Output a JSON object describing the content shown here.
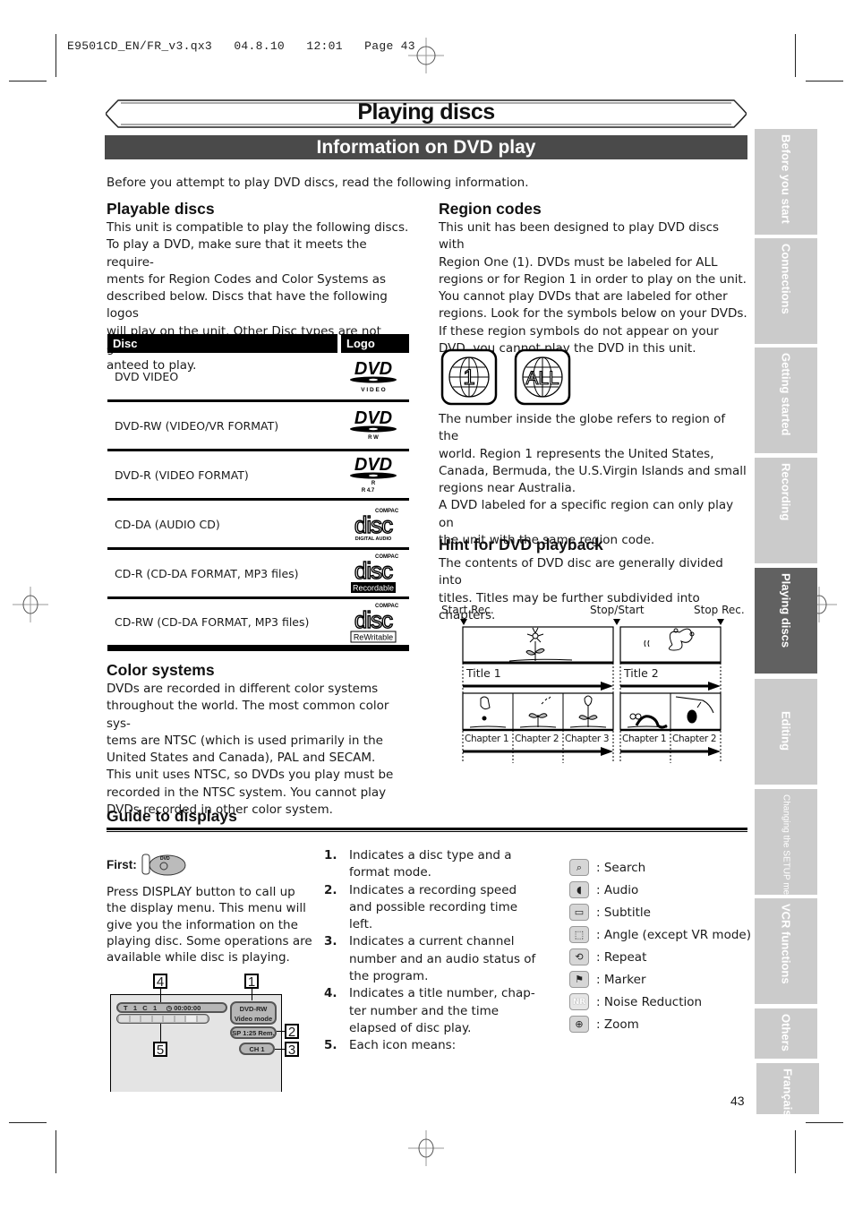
{
  "slug": "E9501CD_EN/FR_v3.qx3   04.8.10   12:01   Page 43",
  "page_title": "Playing discs",
  "section_title": "Information on DVD play",
  "intro": "Before you attempt to play DVD discs, read the following information.",
  "playable": {
    "heading": "Playable discs",
    "lines": [
      "This unit is compatible to play the following discs.",
      "To play a DVD, make sure that it meets the require-",
      "ments for Region Codes and Color Systems as",
      "described below. Discs that have the following logos",
      "will play on the unit. Other Disc types are not guar-",
      "anteed to play."
    ],
    "table": {
      "headers": [
        "Disc",
        "Logo"
      ],
      "rows": [
        {
          "disc": "DVD VIDEO",
          "logo": "dvd-video-logo",
          "sub": "V I D E O"
        },
        {
          "disc": "DVD-RW (VIDEO/VR FORMAT)",
          "logo": "dvd-rw-logo",
          "sub": "R W"
        },
        {
          "disc": "DVD-R (VIDEO FORMAT)",
          "logo": "dvd-r-logo",
          "sub": "R 4.7"
        },
        {
          "disc": "CD-DA (AUDIO CD)",
          "logo": "cd-digital-audio-logo",
          "sub": "DIGITAL AUDIO"
        },
        {
          "disc": "CD-R (CD-DA FORMAT, MP3 files)",
          "logo": "cd-recordable-logo",
          "sub": "Recordable"
        },
        {
          "disc": "CD-RW (CD-DA FORMAT, MP3 files)",
          "logo": "cd-rewritable-logo",
          "sub": "ReWritable"
        }
      ]
    }
  },
  "color_systems": {
    "heading": "Color systems",
    "lines": [
      "DVDs are recorded in different color systems",
      "throughout the world. The most common color sys-",
      "tems are NTSC (which is used primarily in the",
      "United States and Canada), PAL and SECAM.",
      "This unit uses NTSC, so DVDs you play must be",
      "recorded in the NTSC system. You cannot play",
      "DVDs recorded in other color system."
    ]
  },
  "region_codes": {
    "heading": "Region codes",
    "lines": [
      "This unit has been designed to play DVD discs with",
      "Region One (1). DVDs must be labeled for ALL",
      "regions or for Region 1 in order to play on the unit.",
      "You cannot play DVDs that are labeled for other",
      "regions. Look for the symbols below on your DVDs.",
      "If these region symbols do not appear on your",
      "DVD, you cannot play the DVD in this unit."
    ],
    "symbols": [
      "1",
      "ALL"
    ],
    "lines2": [
      "The number inside the globe refers to region of the",
      "world. Region 1 represents the United States,",
      "Canada, Bermuda, the U.S.Virgin Islands and small",
      "regions near Australia.",
      "A DVD labeled for a specific region can only play on",
      "the unit with the same region code."
    ]
  },
  "hint": {
    "heading": "Hint for DVD playback",
    "lines": [
      "The contents of DVD disc are generally divided into",
      "titles. Titles may be further subdivided into chapters."
    ],
    "diagram": {
      "markers": [
        "Start Rec.",
        "Stop/Start",
        "Stop Rec."
      ],
      "titles": [
        "Title 1",
        "Title 2"
      ],
      "chapters_title1": [
        "Chapter 1",
        "Chapter 2",
        "Chapter 3"
      ],
      "chapters_title2": [
        "Chapter 1",
        "Chapter 2"
      ]
    }
  },
  "guide": {
    "heading": "Guide to displays",
    "first_label": "First:",
    "first_button": "DVD",
    "lines": [
      "Press DISPLAY button to call up",
      "the display menu. This menu will",
      "give you the information on the",
      "playing disc. Some operations are",
      "available while disc is playing."
    ],
    "screen": {
      "status_line": {
        "t": "T",
        "title": "1",
        "c": "C",
        "chapter": "1",
        "time": "00:00:00"
      },
      "disc": "DVD-RW",
      "mode": "Video mode",
      "rec": "SP 1:25 Rem.",
      "channel": "CH 1",
      "callouts": [
        "1",
        "2",
        "3",
        "4",
        "5"
      ]
    },
    "numbered": [
      {
        "n": "1.",
        "lines": [
          "Indicates a disc type and a",
          "format mode."
        ]
      },
      {
        "n": "2.",
        "lines": [
          "Indicates a recording speed",
          "and possible recording time",
          "left."
        ]
      },
      {
        "n": "3.",
        "lines": [
          "Indicates a current channel",
          "number and an audio status of",
          "the program."
        ]
      },
      {
        "n": "4.",
        "lines": [
          "Indicates a title number, chap-",
          "ter number and the time",
          "elapsed of disc play."
        ]
      },
      {
        "n": "5.",
        "lines": [
          "Each icon means:"
        ]
      }
    ],
    "icons": [
      {
        "icon": "search-icon",
        "glyph": "⌕",
        "label": ": Search"
      },
      {
        "icon": "audio-icon",
        "glyph": "◖",
        "label": ": Audio"
      },
      {
        "icon": "subtitle-icon",
        "glyph": "▭",
        "label": ": Subtitle"
      },
      {
        "icon": "angle-icon",
        "glyph": "⬚",
        "label": ": Angle (except VR mode)"
      },
      {
        "icon": "repeat-icon",
        "glyph": "⟲",
        "label": ": Repeat"
      },
      {
        "icon": "marker-icon",
        "glyph": "⚑",
        "label": ": Marker"
      },
      {
        "icon": "noise-reduction-icon",
        "glyph": "NR",
        "label": ": Noise Reduction"
      },
      {
        "icon": "zoom-icon",
        "glyph": "⊕",
        "label": ": Zoom"
      }
    ]
  },
  "side_tabs": [
    {
      "label": "Before you start",
      "active": false
    },
    {
      "label": "Connections",
      "active": false
    },
    {
      "label": "Getting started",
      "active": false
    },
    {
      "label": "Recording",
      "active": false
    },
    {
      "label": "Playing discs",
      "active": true
    },
    {
      "label": "Editing",
      "active": false
    },
    {
      "label": "Changing the SETUP menu",
      "active": false
    },
    {
      "label": "VCR functions",
      "active": false
    },
    {
      "label": "Others",
      "active": false
    },
    {
      "label": "Français",
      "active": false
    }
  ],
  "page_number": "43"
}
